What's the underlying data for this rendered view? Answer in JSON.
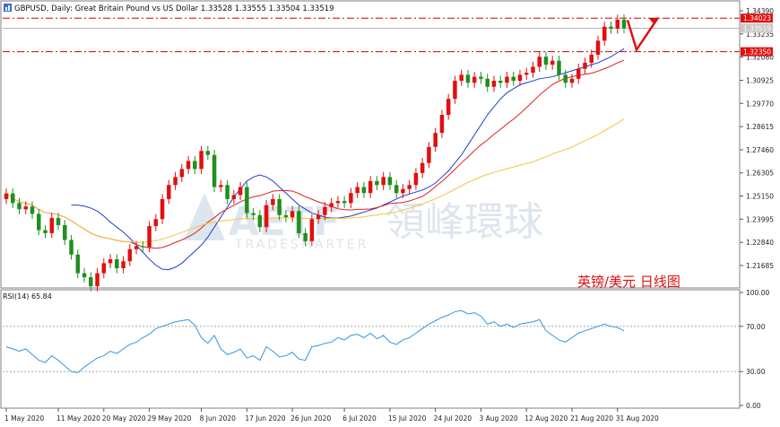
{
  "header": {
    "symbol_line": "GBPUSD, Daily:  Great Britain Pound vs US Dollar  1.33528 1.33555 1.33504 1.33519",
    "indicator_label": "RSI(14) 65.84",
    "watermark_main": "領峰環球",
    "watermark_sub": "TRADESMARTER",
    "annotation_cn": "英镑/美元  日线图"
  },
  "colors": {
    "bull": "#ffffff",
    "bear": "#1a1a1a",
    "candle_up_body": "#e01010",
    "candle_down_body": "#1f8f1f",
    "ma_fast": "#1a3fd6",
    "ma_mid": "#e02020",
    "ma_slow": "#f2c53d",
    "level_line": "#cc0000",
    "rsi_line": "#2f97e0",
    "price_tag_bg": "#e01010",
    "axis_text": "#222222"
  },
  "chart_data": [
    {
      "type": "candlestick",
      "title": "GBPUSD, Daily",
      "price_axis": {
        "ticks": [
          "1.34390",
          "1.33235",
          "1.32080",
          "1.30925",
          "1.29770",
          "1.28615",
          "1.27460",
          "1.26305",
          "1.25150",
          "1.23995",
          "1.22840",
          "1.21685"
        ],
        "range": [
          1.207,
          1.3475
        ]
      },
      "price_tags": [
        "1.34023",
        "1.33519",
        "1.32350"
      ],
      "levels": [
        1.34023,
        1.3235
      ],
      "current_price": 1.33519,
      "date_labels": [
        "1 May 2020",
        "11 May 2020",
        "20 May 2020",
        "29 May 2020",
        "8 Jun 2020",
        "17 Jun 2020",
        "26 Jun 2020",
        "6 Jul 2020",
        "15 Jul 2020",
        "24 Jul 2020",
        "3 Aug 2020",
        "12 Aug 2020",
        "21 Aug 2020",
        "31 Aug 2020"
      ],
      "date_label_bar_index": [
        0,
        8,
        15,
        22,
        30,
        37,
        44,
        52,
        59,
        66,
        73,
        80,
        87,
        94
      ],
      "candles_close": [
        1.2528,
        1.248,
        1.2449,
        1.2463,
        1.2426,
        1.2345,
        1.233,
        1.2406,
        1.237,
        1.2296,
        1.2223,
        1.213,
        1.211,
        1.2065,
        1.213,
        1.218,
        1.22,
        1.2155,
        1.219,
        1.225,
        1.2265,
        1.226,
        1.2365,
        1.24,
        1.25,
        1.257,
        1.261,
        1.265,
        1.269,
        1.265,
        1.274,
        1.272,
        1.256,
        1.257,
        1.25,
        1.252,
        1.256,
        1.243,
        1.242,
        1.236,
        1.247,
        1.25,
        1.242,
        1.241,
        1.244,
        1.233,
        1.229,
        1.24,
        1.242,
        1.246,
        1.248,
        1.249,
        1.248,
        1.253,
        1.256,
        1.253,
        1.259,
        1.257,
        1.261,
        1.257,
        1.253,
        1.255,
        1.257,
        1.263,
        1.268,
        1.276,
        1.283,
        1.292,
        1.3,
        1.309,
        1.312,
        1.308,
        1.311,
        1.31,
        1.306,
        1.309,
        1.308,
        1.311,
        1.309,
        1.312,
        1.313,
        1.316,
        1.321,
        1.317,
        1.319,
        1.312,
        1.308,
        1.31,
        1.315,
        1.318,
        1.322,
        1.329,
        1.336,
        1.335,
        1.3395,
        1.3352
      ],
      "candles_open": [
        1.25,
        1.2528,
        1.248,
        1.2449,
        1.2463,
        1.2426,
        1.2345,
        1.233,
        1.2406,
        1.237,
        1.2296,
        1.2223,
        1.213,
        1.211,
        1.2065,
        1.213,
        1.218,
        1.22,
        1.2155,
        1.219,
        1.225,
        1.2265,
        1.226,
        1.2365,
        1.24,
        1.25,
        1.257,
        1.261,
        1.265,
        1.269,
        1.265,
        1.274,
        1.272,
        1.256,
        1.257,
        1.25,
        1.252,
        1.256,
        1.243,
        1.242,
        1.236,
        1.247,
        1.25,
        1.242,
        1.241,
        1.244,
        1.233,
        1.229,
        1.24,
        1.242,
        1.246,
        1.248,
        1.249,
        1.248,
        1.253,
        1.256,
        1.253,
        1.259,
        1.257,
        1.261,
        1.257,
        1.253,
        1.255,
        1.257,
        1.263,
        1.268,
        1.276,
        1.283,
        1.292,
        1.3,
        1.309,
        1.312,
        1.308,
        1.311,
        1.31,
        1.306,
        1.309,
        1.308,
        1.311,
        1.309,
        1.312,
        1.313,
        1.316,
        1.321,
        1.317,
        1.319,
        1.312,
        1.308,
        1.31,
        1.315,
        1.318,
        1.322,
        1.329,
        1.336,
        1.335,
        1.3395
      ],
      "ma_fast": [
        1.247,
        1.247,
        1.2465,
        1.2455,
        1.244,
        1.2415,
        1.2385,
        1.236,
        1.2335,
        1.2305,
        1.227,
        1.2235,
        1.22,
        1.217,
        1.215,
        1.2148,
        1.216,
        1.218,
        1.221,
        1.224,
        1.227,
        1.231,
        1.236,
        1.241,
        1.246,
        1.251,
        1.255,
        1.259,
        1.261,
        1.262,
        1.261,
        1.259,
        1.256,
        1.253,
        1.25,
        1.247,
        1.245,
        1.243,
        1.242,
        1.241,
        1.2405,
        1.2405,
        1.241,
        1.2415,
        1.2425,
        1.2435,
        1.2445,
        1.2455,
        1.247,
        1.2485,
        1.25,
        1.2515,
        1.2525,
        1.2535,
        1.2545,
        1.256,
        1.258,
        1.261,
        1.264,
        1.268,
        1.272,
        1.277,
        1.282,
        1.287,
        1.292,
        1.296,
        1.3,
        1.303,
        1.305,
        1.307,
        1.308,
        1.309,
        1.31,
        1.3105,
        1.311,
        1.312,
        1.313,
        1.314,
        1.315,
        1.316,
        1.317,
        1.318,
        1.3195,
        1.321,
        1.323,
        1.325
      ],
      "rsi": {
        "label": "RSI(14) 65.84",
        "range": [
          0,
          100
        ],
        "ticks": [
          "100.00",
          "70.00",
          "30.00",
          "0.00"
        ],
        "levels": [
          70,
          30
        ],
        "last": 65.84,
        "values": [
          52,
          50,
          48,
          50,
          45,
          40,
          38,
          44,
          40,
          35,
          30,
          29,
          34,
          38,
          42,
          44,
          48,
          46,
          50,
          54,
          56,
          60,
          63,
          68,
          70,
          72,
          74,
          75,
          76,
          71,
          60,
          55,
          62,
          50,
          45,
          47,
          50,
          42,
          44,
          40,
          52,
          48,
          43,
          44,
          47,
          41,
          40,
          52,
          53,
          55,
          56,
          60,
          58,
          62,
          63,
          60,
          64,
          59,
          62,
          56,
          54,
          58,
          60,
          64,
          68,
          72,
          75,
          78,
          80,
          83,
          84,
          81,
          82,
          79,
          72,
          74,
          70,
          72,
          69,
          72,
          73,
          74,
          76,
          66,
          62,
          58,
          56,
          60,
          64,
          66,
          68,
          70,
          72,
          70,
          69,
          66
        ]
      }
    }
  ]
}
